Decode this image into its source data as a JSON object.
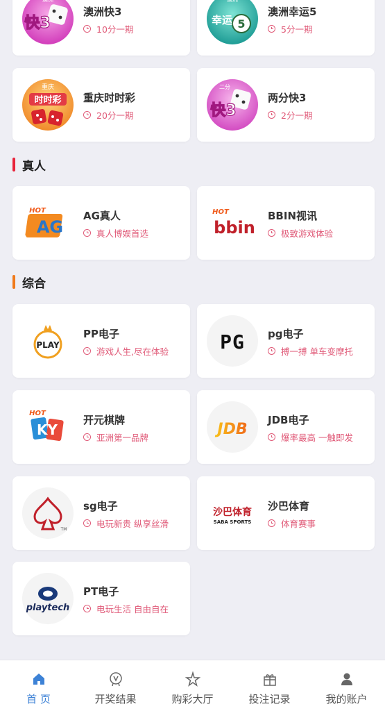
{
  "lottery_cards": [
    {
      "title": "澳洲快3",
      "sub": "10分一期",
      "logo": "dice-k3-pink-icon",
      "logo_text": "快3",
      "logo_top": "澳洲"
    },
    {
      "title": "澳洲幸运5",
      "sub": "5分一期",
      "logo": "lucky5-teal-icon",
      "logo_text": "幸运",
      "logo_top": "澳洲"
    },
    {
      "title": "重庆时时彩",
      "sub": "20分一期",
      "logo": "ssc-orange-icon",
      "logo_text": "时时彩",
      "logo_top": "重庆"
    },
    {
      "title": "两分快3",
      "sub": "2分一期",
      "logo": "dice-k3-pink-icon",
      "logo_text": "快3",
      "logo_top": "二分"
    }
  ],
  "sections": [
    {
      "title": "真人",
      "color": "#e8233a",
      "cards": [
        {
          "title": "AG真人",
          "sub": "真人博娱首选",
          "logo": "ag-hot-logo-icon",
          "logo_text": "AG"
        },
        {
          "title": "BBIN视讯",
          "sub": "极致游戏体验",
          "logo": "bbin-hot-logo-icon",
          "logo_text": "bbin"
        }
      ]
    },
    {
      "title": "综合",
      "color": "#f07a1a",
      "cards": [
        {
          "title": "PP电子",
          "sub": "游戏人生,尽在体验",
          "logo": "pp-play-logo-icon",
          "logo_text": "PLAY"
        },
        {
          "title": "pg电子",
          "sub": "搏一搏 单车变摩托",
          "logo": "pg-logo-icon",
          "logo_text": "PG"
        },
        {
          "title": "开元棋牌",
          "sub": "亚洲第一品牌",
          "logo": "ky-hot-logo-icon",
          "logo_text": "KY"
        },
        {
          "title": "JDB电子",
          "sub": "爆率最高 一触即发",
          "logo": "jdb-logo-icon",
          "logo_text": "JDB"
        },
        {
          "title": "sg电子",
          "sub": "电玩新贵 纵享丝滑",
          "logo": "sg-spade-logo-icon",
          "logo_text": "TM"
        },
        {
          "title": "沙巴体育",
          "sub": "体育赛事",
          "logo": "saba-sports-logo-icon",
          "logo_text": "沙巴体育",
          "logo_text2": "SABA SPORTS"
        },
        {
          "title": "PT电子",
          "sub": "电玩生活 自由自在",
          "logo": "playtech-logo-icon",
          "logo_text": "playtech"
        }
      ]
    }
  ],
  "tabbar": [
    {
      "label": "首 页",
      "icon": "home-icon",
      "active": true
    },
    {
      "label": "开奖结果",
      "icon": "award-medal-icon",
      "active": false
    },
    {
      "label": "购彩大厅",
      "icon": "star-sparkle-icon",
      "active": false
    },
    {
      "label": "投注记录",
      "icon": "gift-icon",
      "active": false
    },
    {
      "label": "我的账户",
      "icon": "user-icon",
      "active": false
    }
  ],
  "colors": {
    "accent": "#3d82d6",
    "subtitle": "#e05a78",
    "background": "#eeeef4"
  }
}
